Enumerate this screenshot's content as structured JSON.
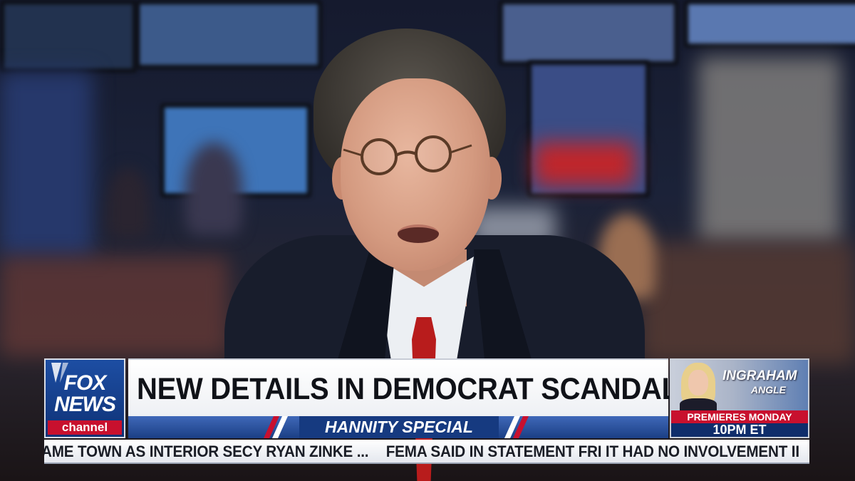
{
  "network_logo": {
    "line1": "FOX",
    "line2": "NEWS",
    "line3": "channel"
  },
  "lower_third": {
    "headline": "NEW DETAILS IN DEMOCRAT SCANDALS",
    "show_name": "HANNITY SPECIAL"
  },
  "promo": {
    "title_line1": "INGRAHAM",
    "title_line2": "ANGLE",
    "premiere_text": "PREMIERES MONDAY",
    "time_text": "10PM ET"
  },
  "ticker": {
    "items": [
      "AME TOWN AS INTERIOR SECY RYAN ZINKE ...",
      "FEMA SAID IN STATEMENT FRI IT HAD NO INVOLVEMENT II"
    ]
  },
  "colors": {
    "brand_blue": "#1d4ea3",
    "brand_red": "#c8102e",
    "headline_text": "#101218"
  }
}
